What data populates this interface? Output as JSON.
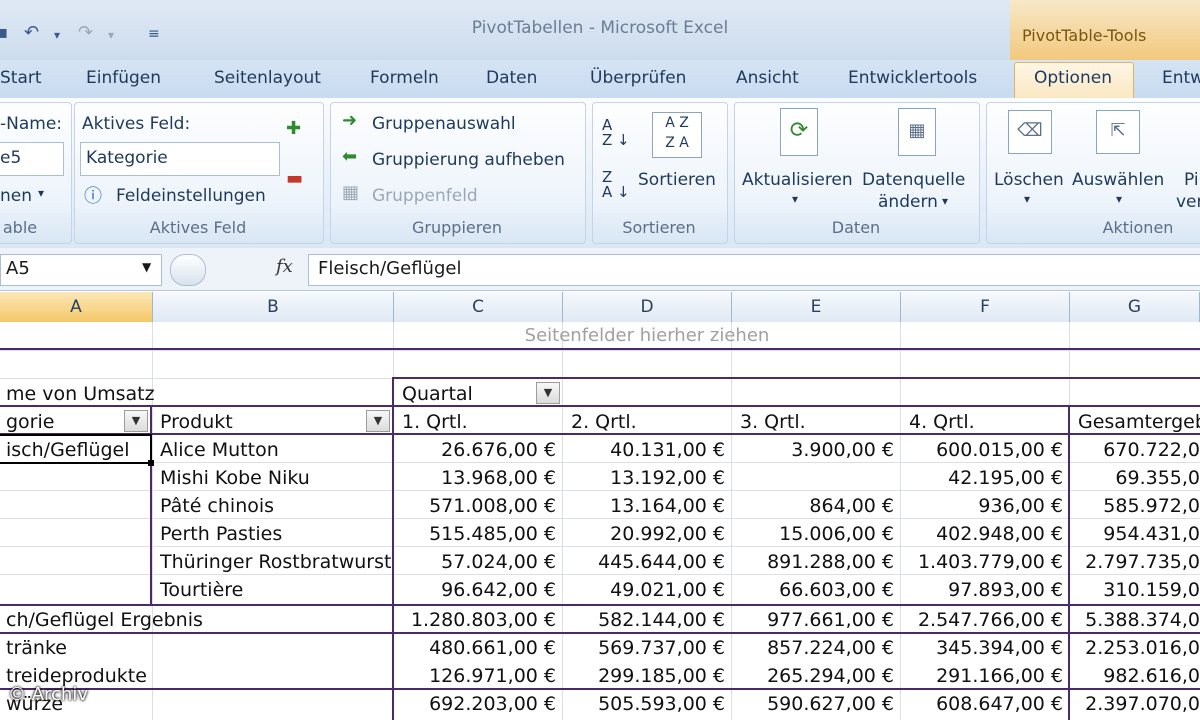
{
  "window": {
    "title": "PivotTabellen  -  Microsoft Excel",
    "context_tab_group": "PivotTable-Tools"
  },
  "tabs": [
    "Start",
    "Einfügen",
    "Seitenlayout",
    "Formeln",
    "Daten",
    "Überprüfen",
    "Ansicht",
    "Entwicklertools",
    "Optionen",
    "Entw"
  ],
  "ribbon": {
    "pivottable_group": {
      "name_label": "-Name:",
      "name_value": "e5",
      "options_label": "nen",
      "group_label": "able"
    },
    "active_field_group": {
      "label": "Aktives Feld:",
      "value": "Kategorie",
      "settings": "Feldeinstellungen",
      "group_label": "Aktives Feld"
    },
    "group_group": {
      "selection": "Gruppenauswahl",
      "ungroup": "Gruppierung aufheben",
      "group_field": "Gruppenfeld",
      "group_label": "Gruppieren"
    },
    "sort_group": {
      "sort": "Sortieren",
      "group_label": "Sortieren"
    },
    "data_group": {
      "refresh": "Aktualisieren",
      "source_line1": "Datenquelle",
      "source_line2": "ändern",
      "group_label": "Daten"
    },
    "actions_group": {
      "clear": "Löschen",
      "select": "Auswählen",
      "move_line1": "Pi",
      "move_line2": "ver",
      "group_label": "Aktionen"
    }
  },
  "formula_bar": {
    "cell_ref": "A5",
    "fx": "fx",
    "value": "Fleisch/Geflügel"
  },
  "columns": [
    "A",
    "B",
    "C",
    "D",
    "E",
    "F",
    "G"
  ],
  "pivot": {
    "page_fields_hint": "Seitenfelder hierher ziehen",
    "data_field": "me von Umsatz",
    "column_field": "Quartal",
    "row_field_1": "gorie",
    "row_field_2": "Produkt",
    "col_headers": [
      "1. Qrtl.",
      "2. Qrtl.",
      "3. Qrtl.",
      "4. Qrtl.",
      "Gesamtergeb"
    ],
    "rows": [
      {
        "a": "isch/Geflügel",
        "b": "Alice Mutton",
        "c": "26.676,00 €",
        "d": "40.131,00 €",
        "e": "3.900,00 €",
        "f": "600.015,00 €",
        "g": "670.722,0"
      },
      {
        "a": "",
        "b": "Mishi Kobe Niku",
        "c": "13.968,00 €",
        "d": "13.192,00 €",
        "e": "",
        "f": "42.195,00 €",
        "g": "69.355,0"
      },
      {
        "a": "",
        "b": "Pâté chinois",
        "c": "571.008,00 €",
        "d": "13.164,00 €",
        "e": "864,00 €",
        "f": "936,00 €",
        "g": "585.972,0"
      },
      {
        "a": "",
        "b": "Perth Pasties",
        "c": "515.485,00 €",
        "d": "20.992,00 €",
        "e": "15.006,00 €",
        "f": "402.948,00 €",
        "g": "954.431,0"
      },
      {
        "a": "",
        "b": "Thüringer Rostbratwurst",
        "c": "57.024,00 €",
        "d": "445.644,00 €",
        "e": "891.288,00 €",
        "f": "1.403.779,00 €",
        "g": "2.797.735,0"
      },
      {
        "a": "",
        "b": "Tourtière",
        "c": "96.642,00 €",
        "d": "49.021,00 €",
        "e": "66.603,00 €",
        "f": "97.893,00 €",
        "g": "310.159,0"
      },
      {
        "a": "ch/Geflügel Ergebnis",
        "b": "",
        "c": "1.280.803,00 €",
        "d": "582.144,00 €",
        "e": "977.661,00 €",
        "f": "2.547.766,00 €",
        "g": "5.388.374,0"
      },
      {
        "a": "tränke",
        "b": "",
        "c": "480.661,00 €",
        "d": "569.737,00 €",
        "e": "857.224,00 €",
        "f": "345.394,00 €",
        "g": "2.253.016,0"
      },
      {
        "a": "treideprodukte",
        "b": "",
        "c": "126.971,00 €",
        "d": "299.185,00 €",
        "e": "265.294,00 €",
        "f": "291.166,00 €",
        "g": "982.616,0"
      },
      {
        "a": "würze",
        "b": "",
        "c": "692.203,00 €",
        "d": "505.593,00 €",
        "e": "590.627,00 €",
        "f": "608.647,00 €",
        "g": "2.397.070,0"
      }
    ]
  },
  "watermark": "© Archiv"
}
